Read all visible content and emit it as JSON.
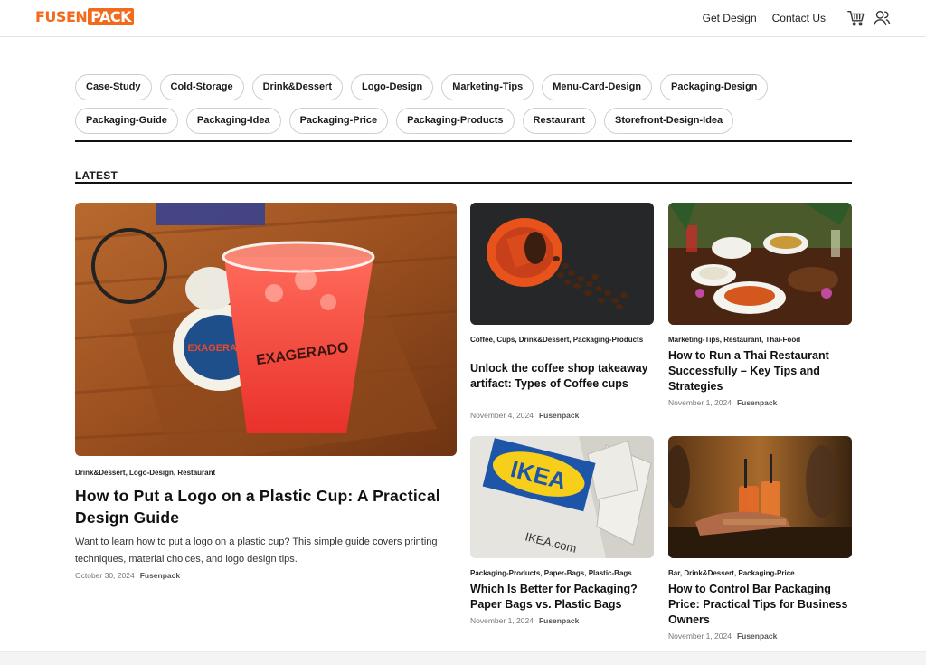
{
  "header": {
    "logo_part1": "FUSEN",
    "logo_part2": "PACK",
    "nav": {
      "get_design": "Get Design",
      "contact_us": "Contact Us"
    },
    "icons": {
      "cart": "cart-icon",
      "account": "user-icon"
    }
  },
  "tags": {
    "row1": [
      "Case-Study",
      "Cold-Storage",
      "Drink&Dessert",
      "Logo-Design",
      "Marketing-Tips",
      "Menu-Card-Design",
      "Packaging-Design"
    ],
    "row2": [
      "Packaging-Guide",
      "Packaging-Idea",
      "Packaging-Price",
      "Packaging-Products",
      "Restaurant",
      "Storefront-Design-Idea"
    ]
  },
  "section": {
    "title": "LATEST"
  },
  "featured": {
    "categories": "Drink&Dessert, Logo-Design, Restaurant",
    "title": "How to Put a Logo on a Plastic Cup: A Practical Design Guide",
    "excerpt": "Want to learn how to put a logo on a plastic cup? This simple guide covers printing techniques, material choices, and logo design tips.",
    "date": "October 30, 2024",
    "author": "Fusenpack",
    "image_text": "EXAGERADO"
  },
  "posts": [
    {
      "categories": "Coffee, Cups, Drink&Dessert, Packaging-Products",
      "title": "Unlock the coffee shop takeaway artifact: Types of Coffee cups",
      "date": "November 4, 2024",
      "author": "Fusenpack"
    },
    {
      "categories": "Marketing-Tips, Restaurant, Thai-Food",
      "title": "How to Run a Thai Restaurant Successfully – Key Tips and Strategies",
      "date": "November 1, 2024",
      "author": "Fusenpack"
    },
    {
      "categories": "Packaging-Products, Paper-Bags, Plastic-Bags",
      "title": "Which Is Better for Packaging? Paper Bags vs. Plastic Bags",
      "date": "November 1, 2024",
      "author": "Fusenpack",
      "image_text_logo": "IKEA",
      "image_text_url": "IKEA.com"
    },
    {
      "categories": "Bar, Drink&Dessert, Packaging-Price",
      "title": "How to Control Bar Packaging Price: Practical Tips for Business Owners",
      "date": "November 1, 2024",
      "author": "Fusenpack"
    }
  ],
  "colors": {
    "brand": "#f26b1d",
    "text": "#1a1a1a",
    "muted": "#777777"
  }
}
